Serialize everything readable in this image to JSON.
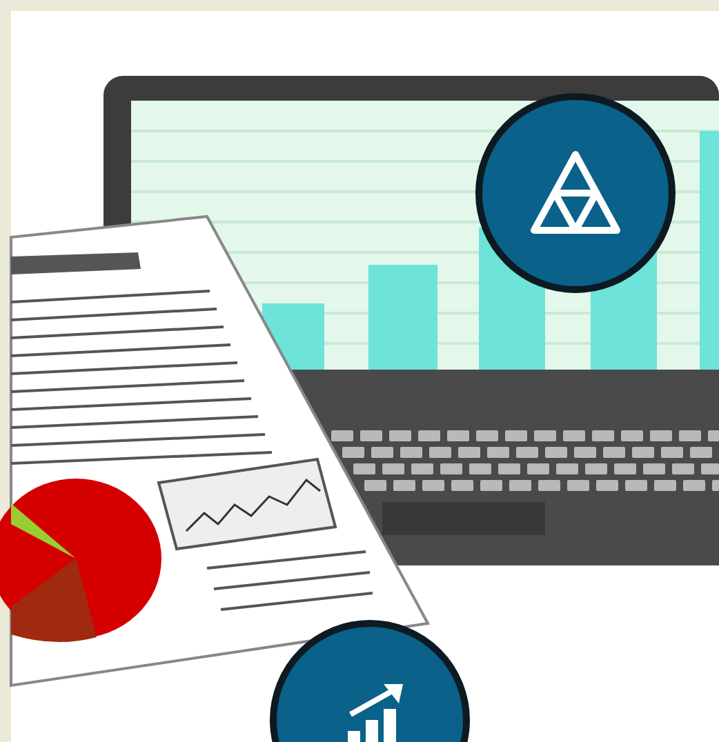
{
  "badges": [
    {
      "kind": "triangle"
    },
    {
      "kind": "growth"
    }
  ]
}
